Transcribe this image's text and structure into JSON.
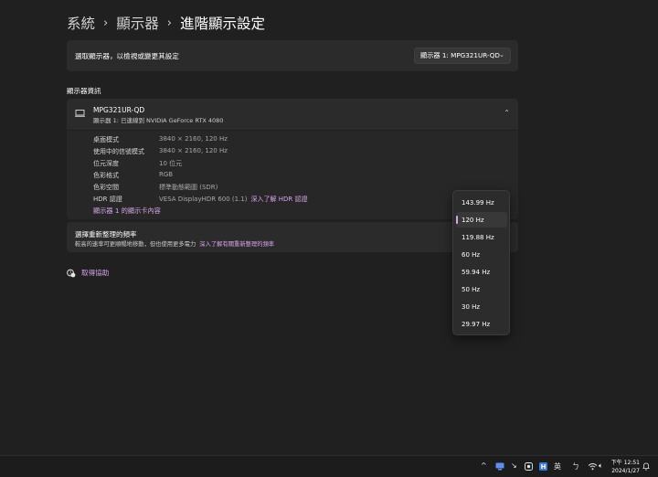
{
  "breadcrumb": [
    "系統",
    "顯示器",
    "進階顯示設定"
  ],
  "select_display": {
    "label": "選取顯示器，以檢視或變更其設定",
    "value": "顯示器 1: MPG321UR-QD"
  },
  "display_info": {
    "section_title": "顯示器資訊",
    "monitor_name": "MPG321UR-QD",
    "monitor_sub": "顯示器 1: 已連線到 NVIDIA GeForce RTX 4080",
    "rows": [
      {
        "key": "桌面模式",
        "value": "3840 × 2160, 120 Hz",
        "link": ""
      },
      {
        "key": "使用中的信號模式",
        "value": "3840 × 2160, 120 Hz",
        "link": ""
      },
      {
        "key": "位元深度",
        "value": "10 位元",
        "link": ""
      },
      {
        "key": "色彩格式",
        "value": "RGB",
        "link": ""
      },
      {
        "key": "色彩空間",
        "value": "標準動態範圍 (SDR)",
        "link": ""
      },
      {
        "key": "HDR 認證",
        "value": "VESA DisplayHDR 600 (1.1)",
        "link": "深入了解 HDR 認證"
      }
    ],
    "adapter_link": "顯示器 1 的顯示卡內容"
  },
  "refresh_rate": {
    "title": "選擇重新整理的頻率",
    "subtitle": "較高的速率可更順暢地移動，但也使用更多電力",
    "link": "深入了解有關重新整理的頻率"
  },
  "help": {
    "label": "取得協助"
  },
  "dropdown": {
    "options": [
      "143.99 Hz",
      "120 Hz",
      "119.88 Hz",
      "60 Hz",
      "59.94 Hz",
      "50 Hz",
      "30 Hz",
      "29.97 Hz"
    ],
    "selected": "120 Hz",
    "accent": "#d6a4e9"
  },
  "taskbar": {
    "ime": "英",
    "time": "下午 12:51",
    "date": "2024/1/27"
  }
}
